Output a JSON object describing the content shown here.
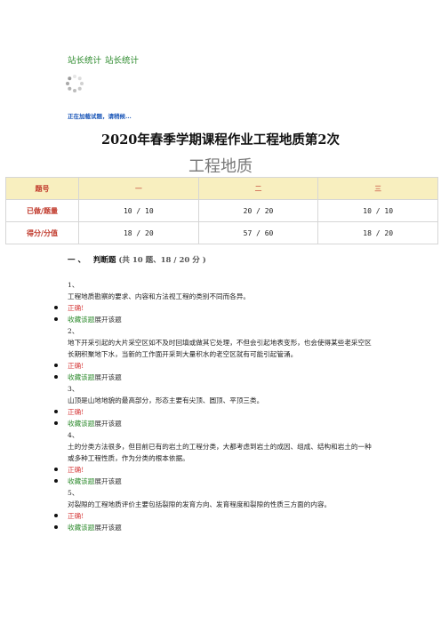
{
  "top_links": [
    "站长统计",
    "站长统计"
  ],
  "loading_text": "正在加载试题，请稍候...",
  "main_title": "2020年春季学期课程作业工程地质第2次",
  "subject": "工程地质",
  "stats_table": {
    "headers": [
      "题号",
      "一",
      "二",
      "三"
    ],
    "rows": [
      {
        "label": "已做/题量",
        "values": [
          "10 / 10",
          "20 / 20",
          "10 / 10"
        ]
      },
      {
        "label": "得分/分值",
        "values": [
          "18 / 20",
          "57 / 60",
          "18 / 20"
        ]
      }
    ]
  },
  "section": {
    "number": "一 、",
    "title": "判断题",
    "meta": "(共 10 题、18 / 20 分 )"
  },
  "questions": [
    {
      "num": "1、",
      "text": "工程地质勘察的要求、内容和方法视工程的类别不同而各异。",
      "result": "正确!",
      "fav": "收藏该题",
      "expand": "展开该题"
    },
    {
      "num": "2、",
      "text": "地下开采引起的大片采空区如不及时回填或做其它处理，不但会引起地表变形，也会使得某些老采空区长期积聚地下水，当新的工作面开采到大量积水的老空区就有可能引起管涌。",
      "result": "正确!",
      "fav": "收藏该题",
      "expand": "展开该题"
    },
    {
      "num": "3、",
      "text": "山顶是山地地貌的最高部分，形态主要有尖顶、圆顶、平顶三类。",
      "result": "正确!",
      "fav": "收藏该题",
      "expand": "展开该题"
    },
    {
      "num": "4、",
      "text": "土的分类方法很多，但目前已有的岩土的工程分类，大都考虑到岩土的成因、组成、结构和岩土的一种或多种工程性质，作为分类的根本依据。",
      "result": "正确!",
      "fav": "收藏该题",
      "expand": "展开该题"
    },
    {
      "num": "5、",
      "text": "对裂隙的工程地质评价主要包括裂隙的发育方向、发育程度和裂隙的性质三方面的内容。",
      "result": "正确!",
      "fav": "收藏该题",
      "expand": "展开该题"
    }
  ]
}
